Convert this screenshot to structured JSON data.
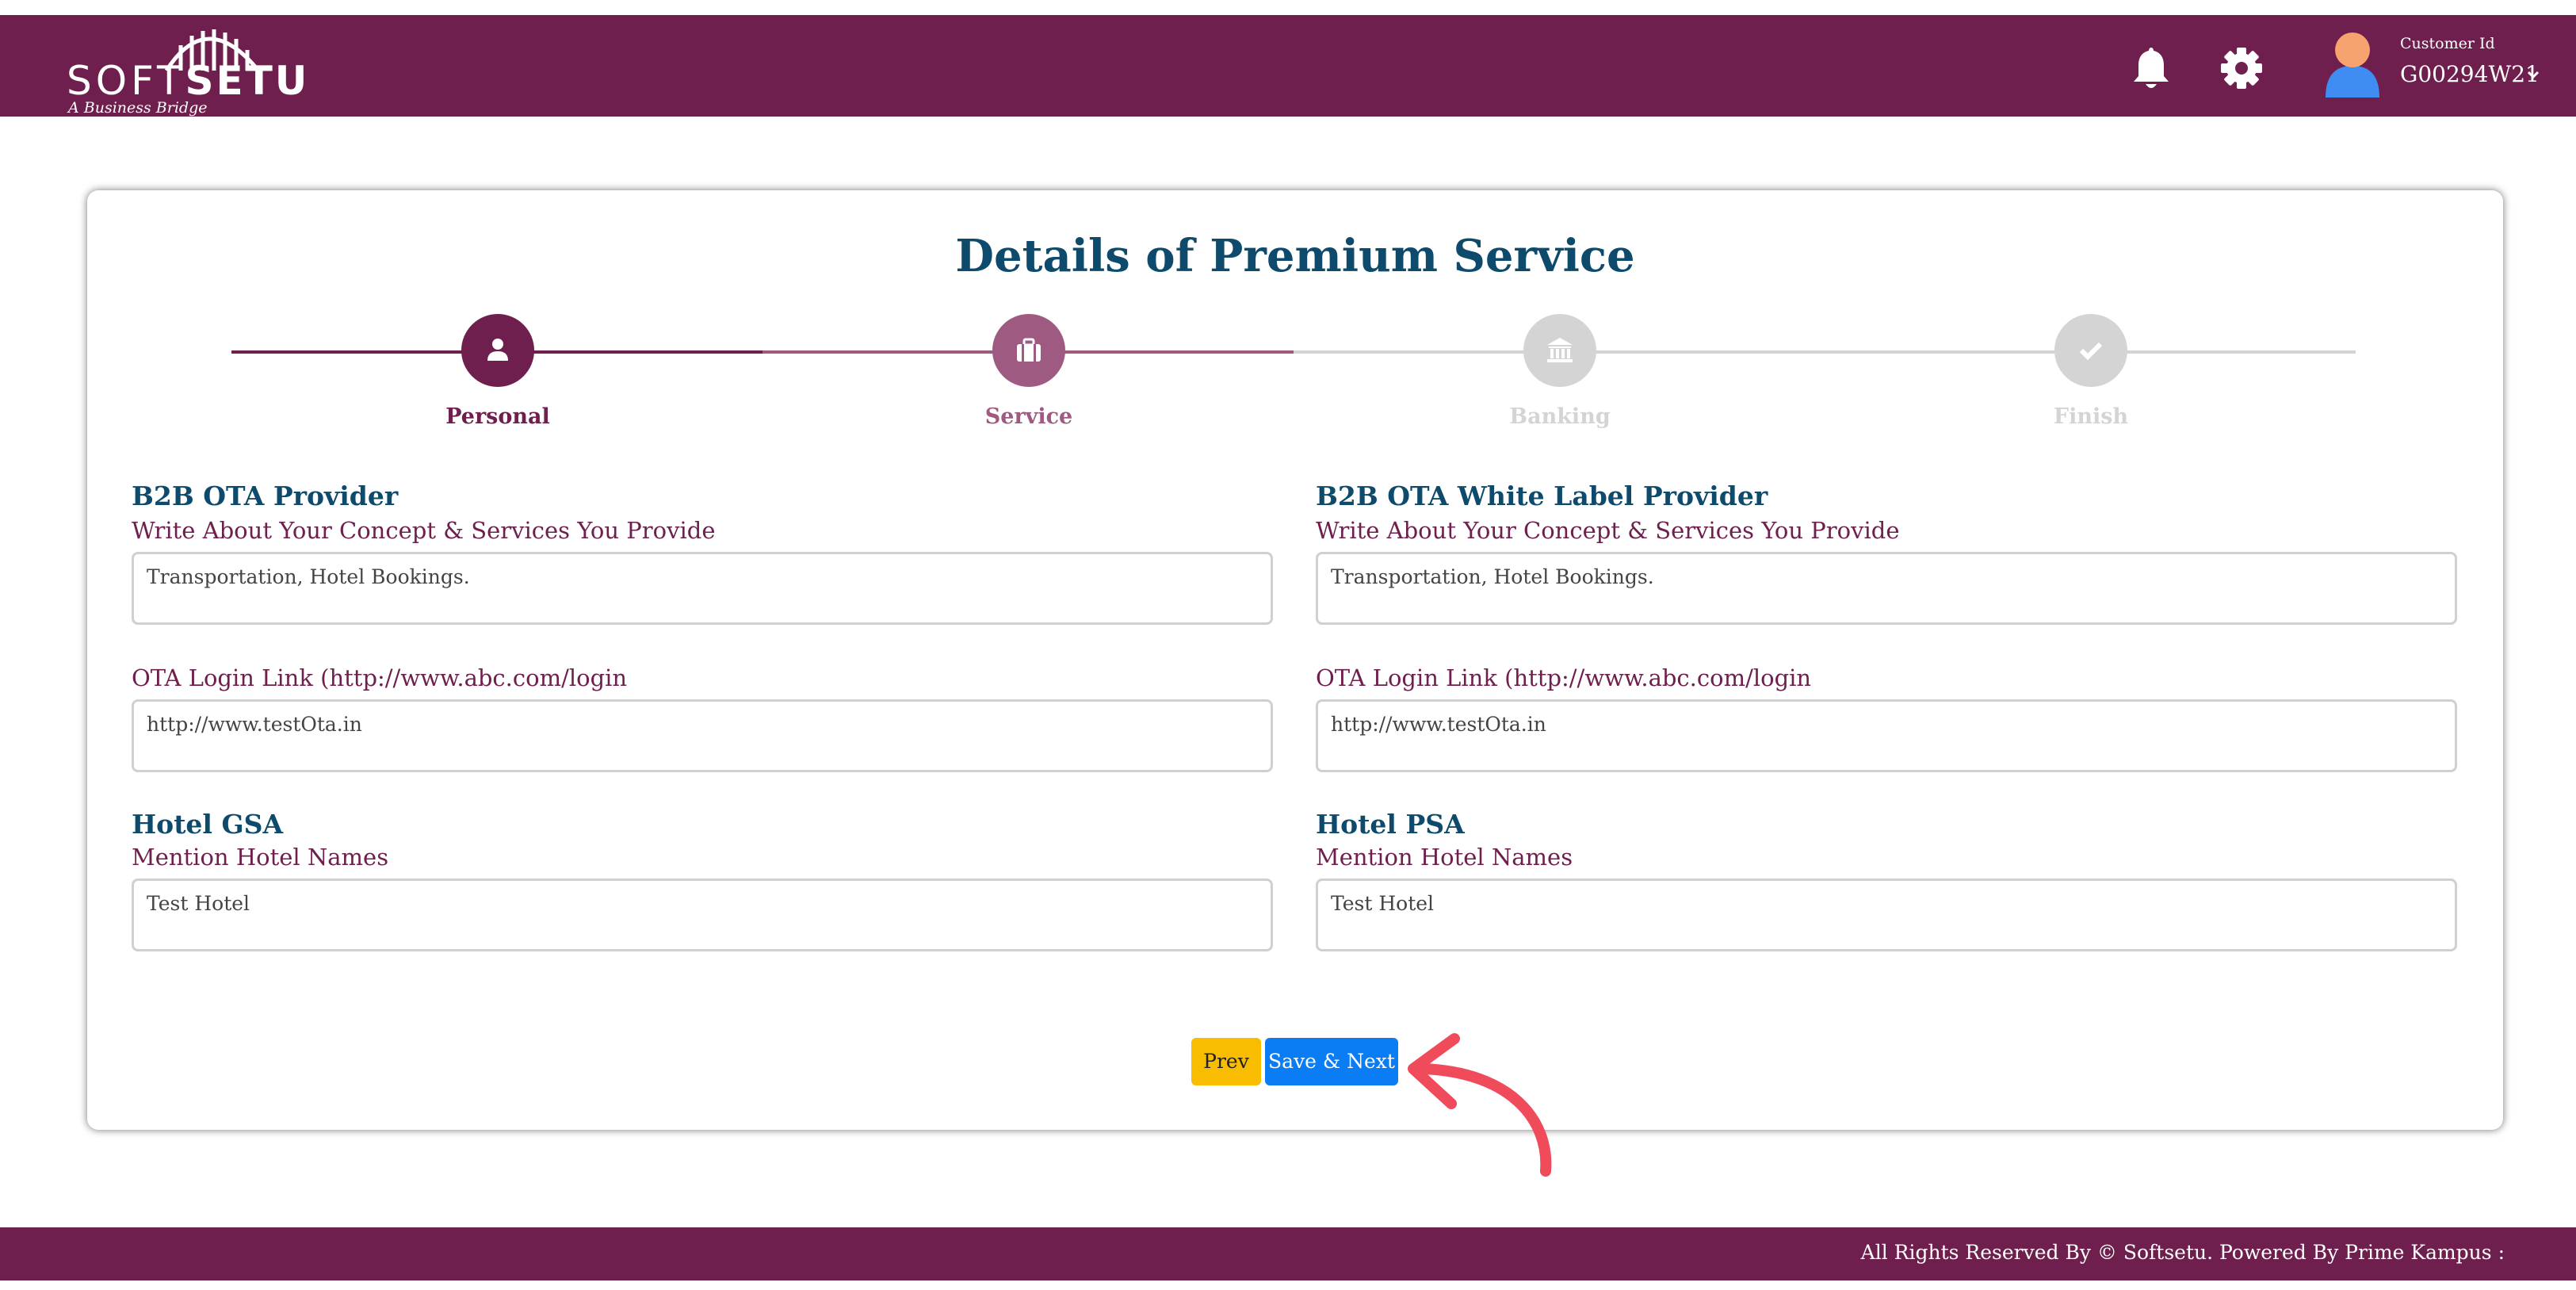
{
  "header": {
    "logo_soft": "SOFT",
    "logo_setu": "SETU",
    "logo_tagline": "A Business Bridge",
    "customer_label": "Customer Id",
    "customer_id": "G00294W21",
    "icons": [
      "bell-icon",
      "gear-icon",
      "user-avatar",
      "chevron-down-icon"
    ]
  },
  "page": {
    "title": "Details of Premium Service"
  },
  "stepper": {
    "steps": [
      {
        "label": "Personal",
        "state": "completed",
        "icon": "user-icon"
      },
      {
        "label": "Service",
        "state": "active",
        "icon": "briefcase-icon"
      },
      {
        "label": "Banking",
        "state": "pending",
        "icon": "bank-icon"
      },
      {
        "label": "Finish",
        "state": "pending",
        "icon": "check-icon"
      }
    ]
  },
  "form": {
    "b2b_ota": {
      "title": "B2B OTA Provider",
      "concept_label": "Write About Your Concept & Services You Provide",
      "concept_value": "Transportation, Hotel Bookings.",
      "login_label": "OTA Login Link (http://www.abc.com/login",
      "login_value": "http://www.testOta.in"
    },
    "b2b_white": {
      "title": "B2B OTA White Label Provider",
      "concept_label": "Write About Your Concept & Services You Provide",
      "concept_value": "Transportation, Hotel Bookings.",
      "login_label": "OTA Login Link (http://www.abc.com/login",
      "login_value": "http://www.testOta.in"
    },
    "hotel_gsa": {
      "title": "Hotel GSA",
      "label": "Mention Hotel Names",
      "value": "Test Hotel"
    },
    "hotel_psa": {
      "title": "Hotel PSA",
      "label": "Mention Hotel Names",
      "value": "Test Hotel"
    }
  },
  "buttons": {
    "prev": "Prev",
    "save_next": "Save & Next"
  },
  "footer": {
    "text": "All Rights Reserved By © Softsetu. Powered By Prime Kampus :"
  },
  "colors": {
    "brand": "#6e1f4d",
    "title": "#0e4a6b",
    "active_step": "#9e5a80",
    "pending": "#d4d4d4",
    "prev_button": "#f8bd00",
    "next_button": "#0a7cf4",
    "annotation_arrow": "#ef4b5b"
  }
}
